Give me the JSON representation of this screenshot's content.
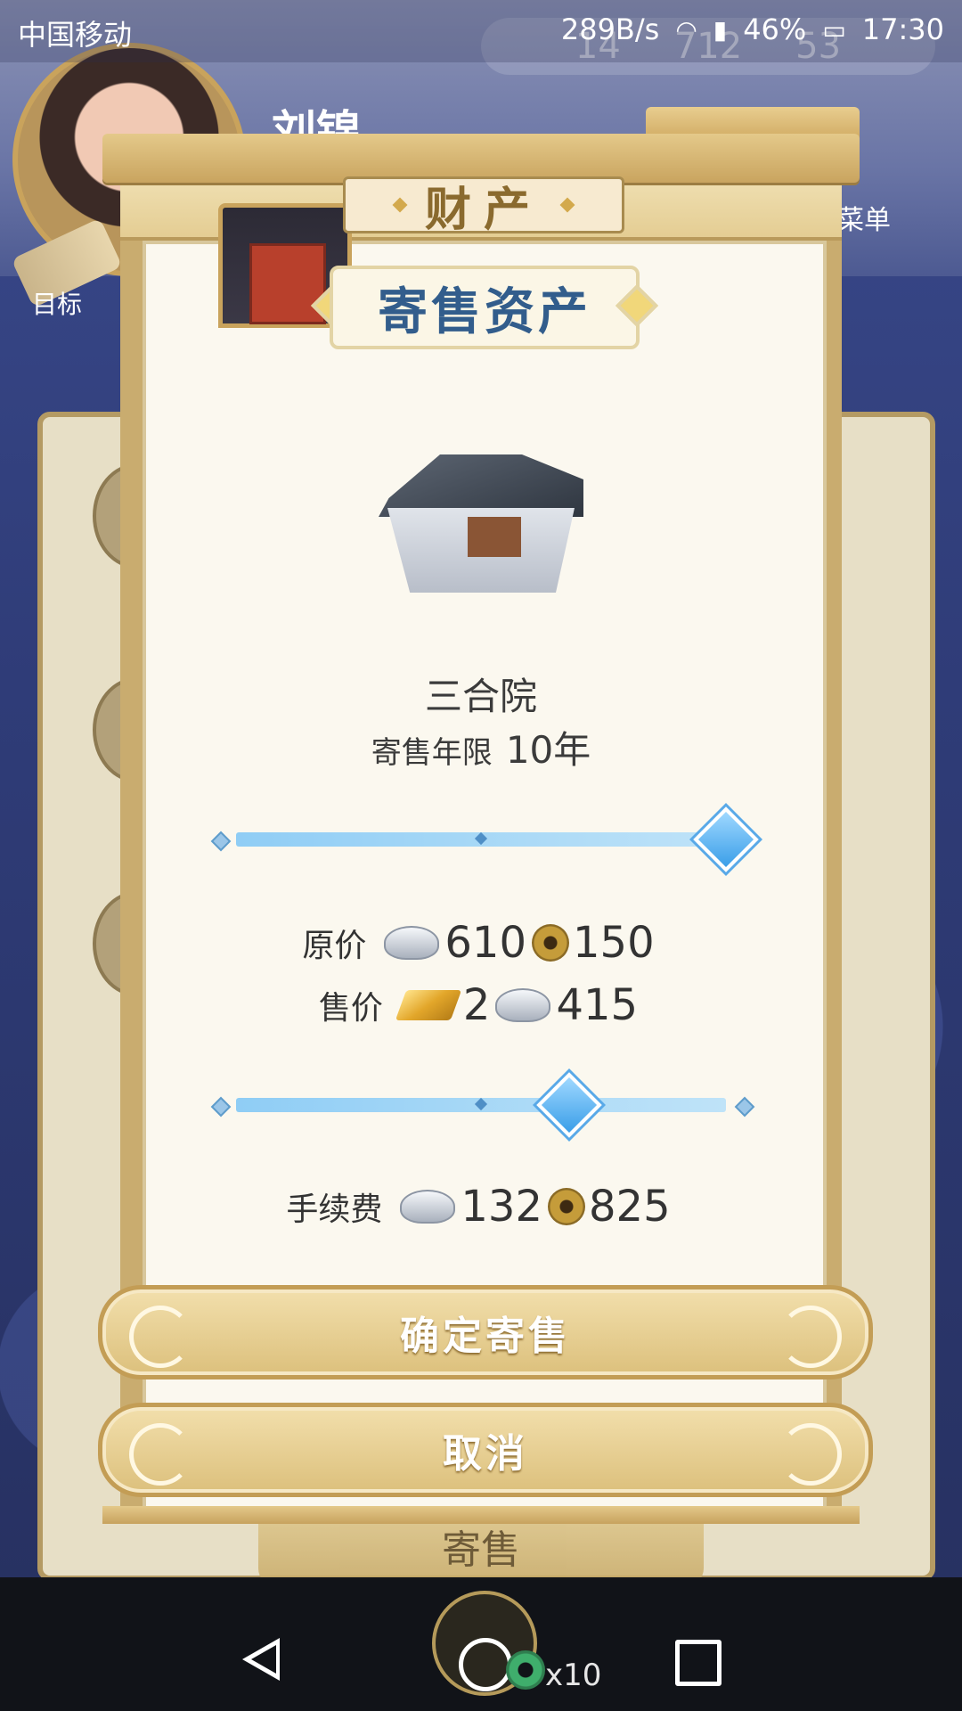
{
  "status_bar": {
    "carrier": "中国移动",
    "net_speed": "289B/s",
    "battery": "46%",
    "time": "17:30"
  },
  "hud": {
    "gold": "14",
    "silver": "712",
    "copper": "53",
    "player_name": "刘锦",
    "goal_label": "目标",
    "menu_label": "菜单",
    "bg_button_label": "寄售"
  },
  "dialog": {
    "title": "财产",
    "section_title": "寄售资产",
    "asset_name": "三合院",
    "term_label": "寄售年限",
    "term_value": "10年",
    "term_slider_level": 1.0,
    "price_slider_level": 0.68,
    "original_price": {
      "label": "原价",
      "silver": "610",
      "copper": "150"
    },
    "sale_price": {
      "label": "售价",
      "gold": "2",
      "silver": "415"
    },
    "fee": {
      "label": "手续费",
      "silver": "132",
      "copper": "825"
    },
    "confirm_button": "确定寄售",
    "cancel_button": "取消"
  },
  "nav": {
    "share_count": "x10"
  },
  "colors": {
    "title_blue": "#325d8c",
    "slider_blue": "#3a9ee8",
    "gold_frame": "#c9ac6f"
  }
}
